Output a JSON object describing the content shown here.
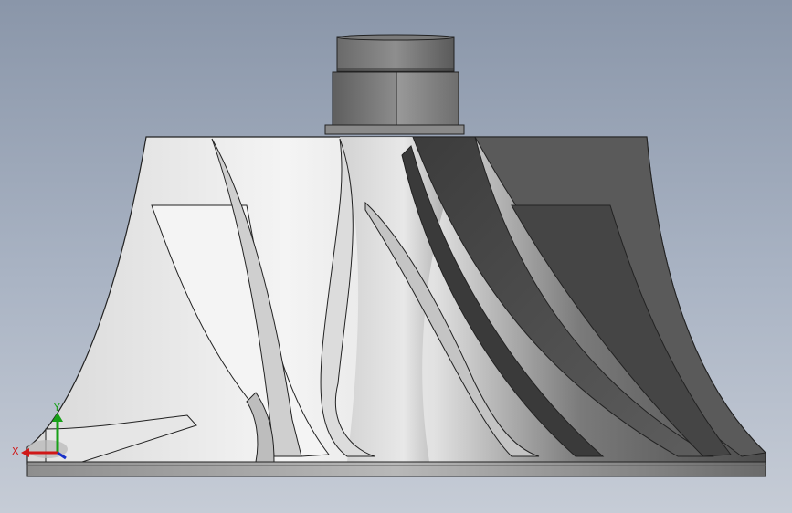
{
  "viewport": {
    "background_top": "#8a96a9",
    "background_bottom": "#c6ccd6"
  },
  "model": {
    "parts": [
      "shaft-cap",
      "hex-nut",
      "hub",
      "base-disc",
      "blades"
    ],
    "colors": {
      "light_face": "#f2f2f2",
      "mid_face": "#b4b4b4",
      "dark_face": "#4a4a4a",
      "edge": "#222222"
    }
  },
  "triad": {
    "x_label": "X",
    "y_label": "Y",
    "x_color": "#d01818",
    "y_color": "#18a018",
    "z_color": "#1830c8"
  }
}
